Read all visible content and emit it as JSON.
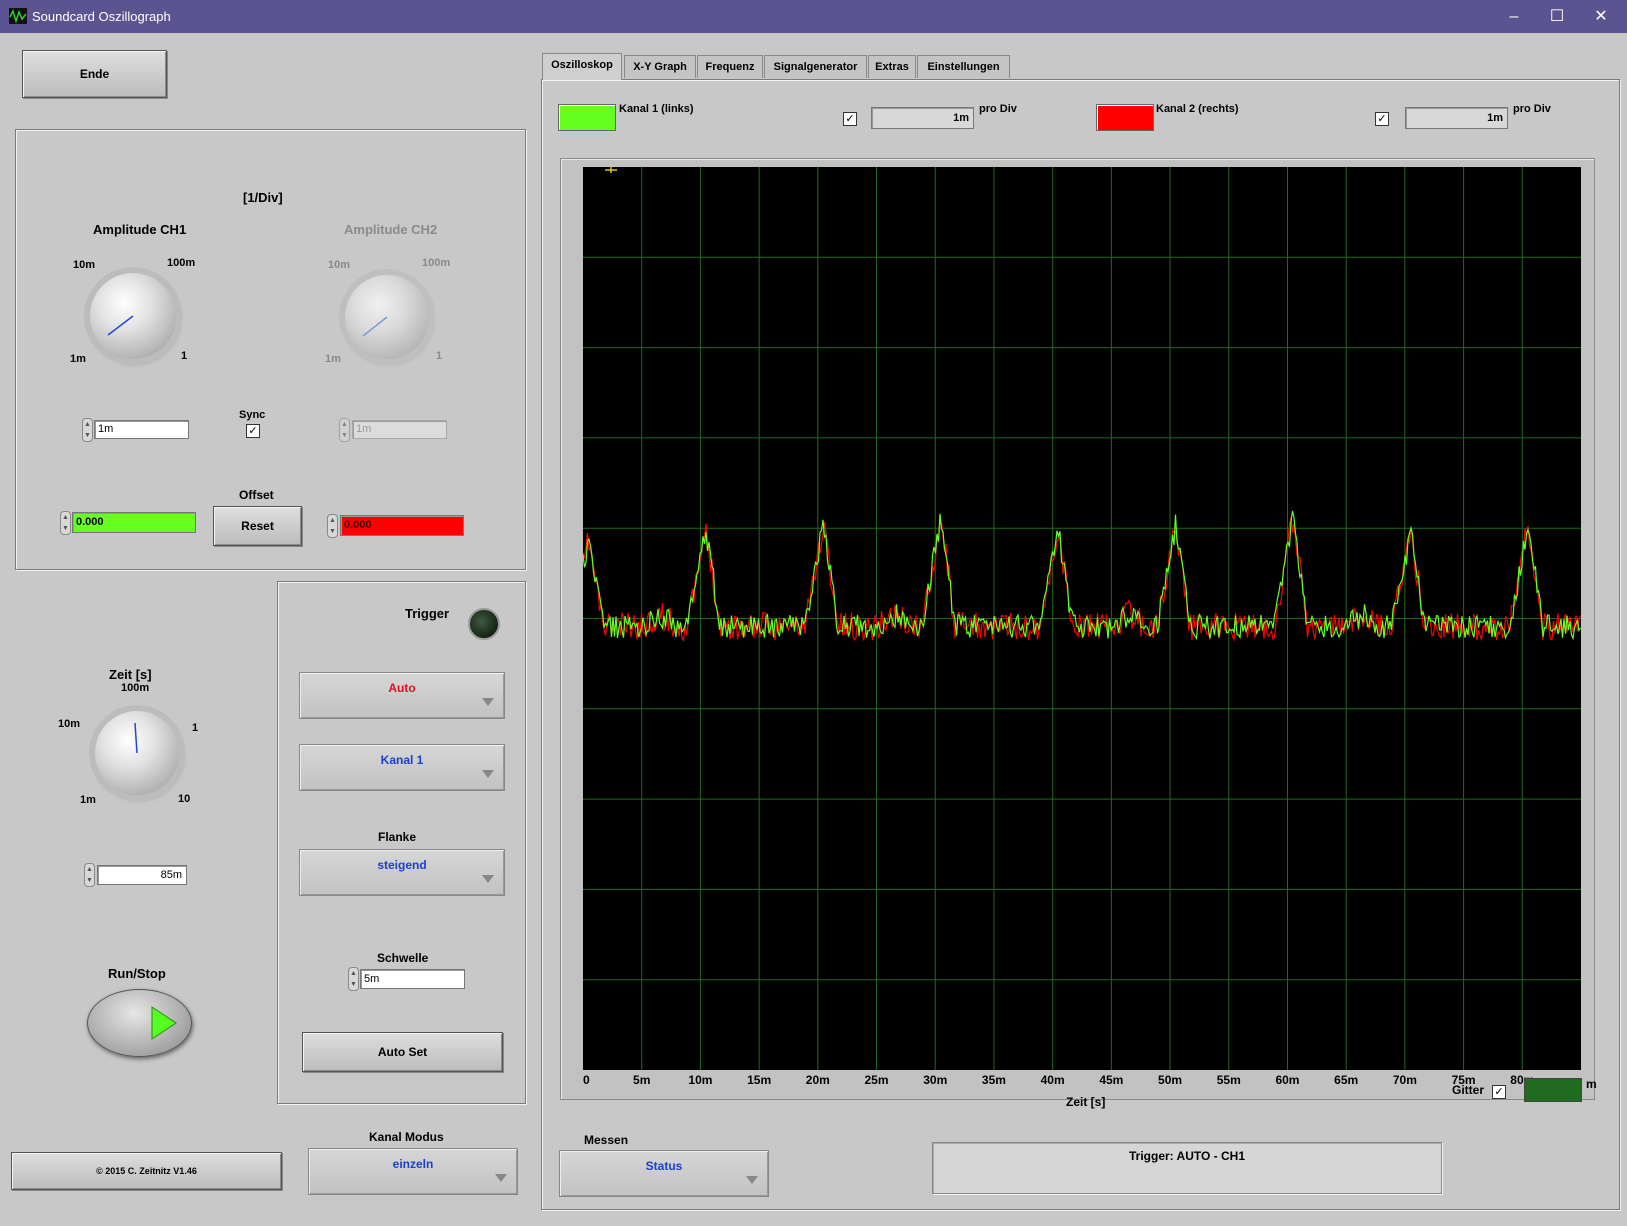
{
  "window": {
    "title": "Soundcard Oszillograph",
    "minimize": "–",
    "maximize": "☐",
    "close": "✕"
  },
  "left": {
    "ende_label": "Ende",
    "amp_section_title": "[1/Div]",
    "amp_ch1": {
      "title": "Amplitude CH1",
      "ticks": {
        "a": "10m",
        "b": "100m",
        "c": "1m",
        "d": "1"
      },
      "value": "1m"
    },
    "amp_ch2": {
      "title": "Amplitude CH2",
      "ticks": {
        "a": "10m",
        "b": "100m",
        "c": "1m",
        "d": "1"
      },
      "value": "1m"
    },
    "sync_label": "Sync",
    "sync_checked": "✓",
    "offset_label": "Offset",
    "offset_ch1": "0.000",
    "offset_ch2": "0.000",
    "reset_label": "Reset",
    "zeit": {
      "title": "Zeit [s]",
      "ticks": {
        "a": "100m",
        "b": "10m",
        "c": "1",
        "d": "1m",
        "e": "10"
      },
      "value": "85m"
    },
    "runstop_label": "Run/Stop",
    "copyright": "© 2015  C. Zeitnitz V1.46",
    "kanal_modus_label": "Kanal Modus",
    "kanal_modus_value": "einzeln"
  },
  "trigger": {
    "title": "Trigger",
    "mode": "Auto",
    "channel": "Kanal 1",
    "flanke_label": "Flanke",
    "flanke_value": "steigend",
    "schwelle_label": "Schwelle",
    "schwelle_value": "5m",
    "autoset_label": "Auto Set"
  },
  "tabs": [
    "Oszilloskop",
    "X-Y Graph",
    "Frequenz",
    "Signalgenerator",
    "Extras",
    "Einstellungen"
  ],
  "channels": {
    "ch1": {
      "label": "Kanal 1 (links)",
      "color": "#66ff22",
      "checked": "✓",
      "value": "1m",
      "unit": "pro Div"
    },
    "ch2": {
      "label": "Kanal 2 (rechts)",
      "color": "#ff0000",
      "checked": "✓",
      "value": "1m",
      "unit": "pro Div"
    }
  },
  "scope": {
    "x_ticks": [
      "0",
      "5m",
      "10m",
      "15m",
      "20m",
      "25m",
      "30m",
      "35m",
      "40m",
      "45m",
      "50m",
      "55m",
      "60m",
      "65m",
      "70m",
      "75m",
      "80m"
    ],
    "x_unit_tail": "m",
    "xlabel": "Zeit [s]",
    "gitter_label": "Gitter",
    "gitter_checked": "✓",
    "grid_color": "#1f6b1f",
    "pulse_period_ms": 10,
    "pulse_first_ms": 10.5
  },
  "messen": {
    "label": "Messen",
    "value": "Status"
  },
  "status_text": "Trigger: AUTO - CH1"
}
